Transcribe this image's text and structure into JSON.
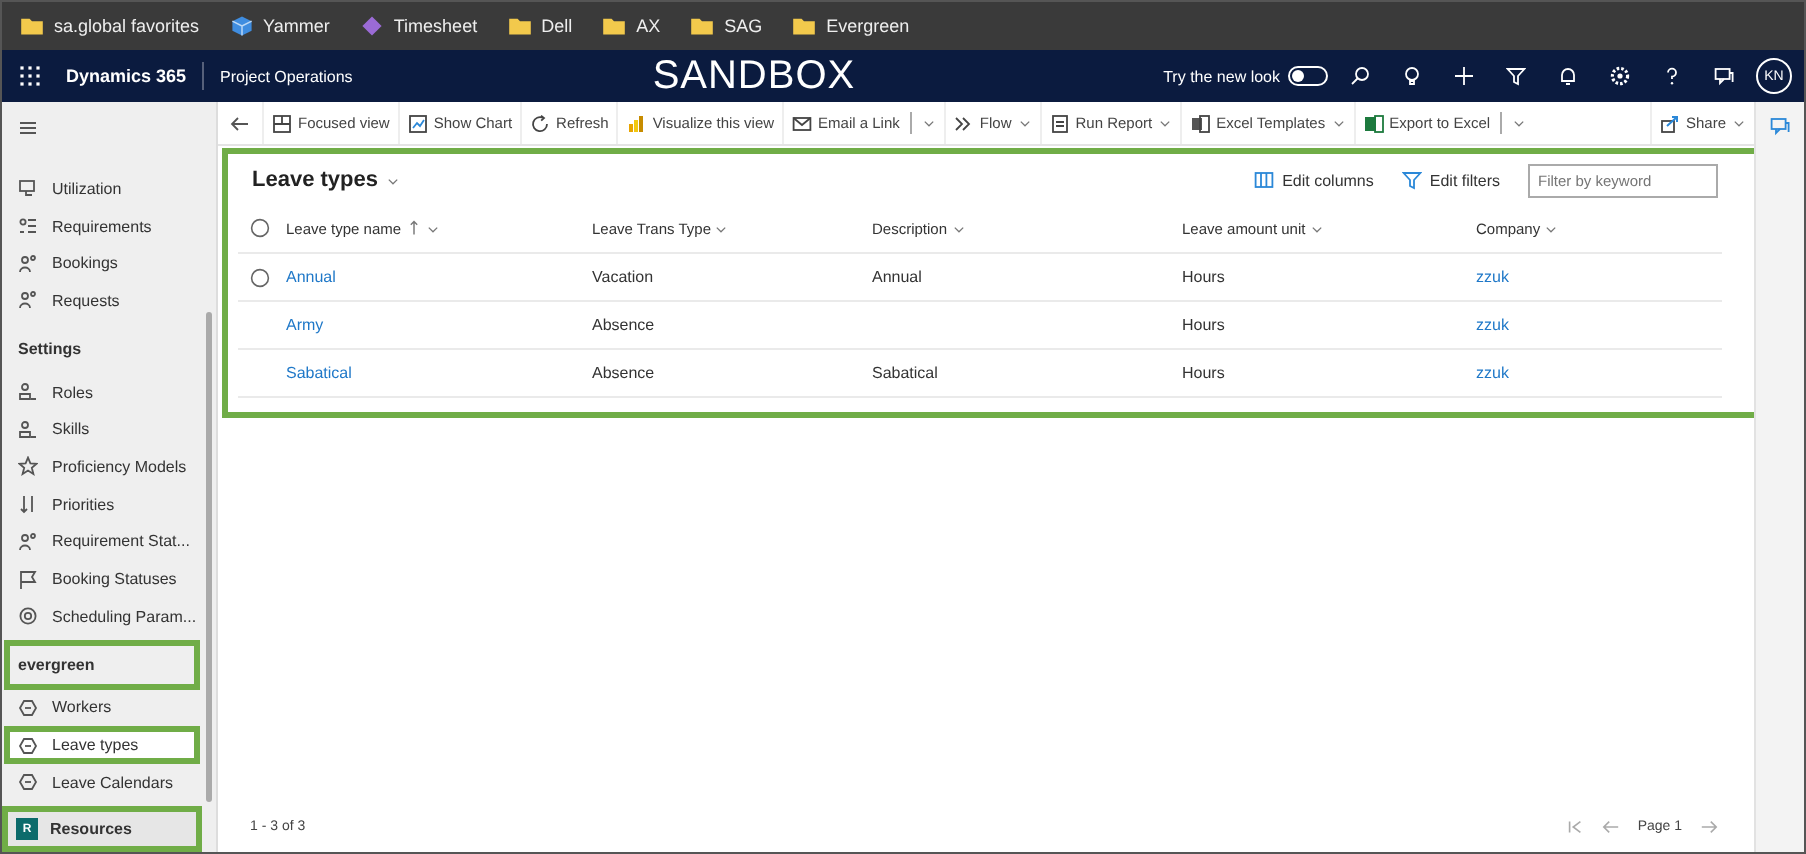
{
  "bookmarks": [
    {
      "label": "sa.global favorites"
    },
    {
      "label": "Yammer"
    },
    {
      "label": "Timesheet"
    },
    {
      "label": "Dell"
    },
    {
      "label": "AX"
    },
    {
      "label": "SAG"
    },
    {
      "label": "Evergreen"
    }
  ],
  "header": {
    "app_name": "Dynamics 365",
    "area": "Project Operations",
    "banner": "SANDBOX",
    "new_look_label": "Try the new look",
    "new_look_on": false,
    "user_initials": "KN"
  },
  "command_bar": [
    {
      "label": "Focused view"
    },
    {
      "label": "Show Chart"
    },
    {
      "label": "Refresh"
    },
    {
      "label": "Visualize this view"
    },
    {
      "label": "Email a Link"
    },
    {
      "label": "Flow"
    },
    {
      "label": "Run Report"
    },
    {
      "label": "Excel Templates"
    },
    {
      "label": "Export to Excel"
    },
    {
      "label": "Share"
    }
  ],
  "sidebar": {
    "sections": [
      {
        "items": [
          {
            "label": "Utilization",
            "selected": false,
            "highlighted": false
          },
          {
            "label": "Requirements",
            "selected": false,
            "highlighted": false
          },
          {
            "label": "Bookings",
            "selected": false,
            "highlighted": false
          },
          {
            "label": "Requests",
            "selected": false,
            "highlighted": false
          }
        ]
      },
      {
        "title": "Settings",
        "highlighted": false,
        "items": [
          {
            "label": "Roles",
            "selected": false,
            "highlighted": false
          },
          {
            "label": "Skills",
            "selected": false,
            "highlighted": false
          },
          {
            "label": "Proficiency Models",
            "selected": false,
            "highlighted": false
          },
          {
            "label": "Priorities",
            "selected": false,
            "highlighted": false
          },
          {
            "label": "Requirement Stat...",
            "selected": false,
            "highlighted": false
          },
          {
            "label": "Booking Statuses",
            "selected": false,
            "highlighted": false
          },
          {
            "label": "Scheduling Param...",
            "selected": false,
            "highlighted": false
          }
        ]
      },
      {
        "title": "evergreen",
        "highlighted": true,
        "items": [
          {
            "label": "Workers",
            "selected": false,
            "highlighted": false
          },
          {
            "label": "Leave types",
            "selected": true,
            "highlighted": true
          },
          {
            "label": "Leave Calendars",
            "selected": false,
            "highlighted": false
          }
        ]
      }
    ],
    "area_switcher": {
      "initial": "R",
      "label": "Resources",
      "highlighted": true
    }
  },
  "grid": {
    "title": "Leave types",
    "highlighted": true,
    "actions": [
      {
        "label": "Edit columns"
      },
      {
        "label": "Edit filters"
      }
    ],
    "filter": {
      "placeholder": "Filter by keyword"
    },
    "columns": [
      {
        "label": "Leave type name",
        "sorted": true,
        "kind": "link"
      },
      {
        "label": "Leave Trans Type",
        "sorted": false,
        "kind": "text"
      },
      {
        "label": "Description",
        "sorted": false,
        "kind": "text"
      },
      {
        "label": "Leave amount unit",
        "sorted": false,
        "kind": "text"
      },
      {
        "label": "Company",
        "sorted": false,
        "kind": "link"
      }
    ],
    "rows": [
      {
        "selected": false,
        "checkbox_visible": true,
        "cells": [
          "Annual",
          "Vacation",
          "Annual",
          "Hours",
          "zzuk"
        ]
      },
      {
        "selected": false,
        "checkbox_visible": false,
        "cells": [
          "Army",
          "Absence",
          "",
          "Hours",
          "zzuk"
        ]
      },
      {
        "selected": false,
        "checkbox_visible": false,
        "cells": [
          "Sabatical",
          "Absence",
          "Sabatical",
          "Hours",
          "zzuk"
        ]
      }
    ],
    "footer": {
      "count": "1 - 3 of 3",
      "page": "Page 1"
    }
  }
}
